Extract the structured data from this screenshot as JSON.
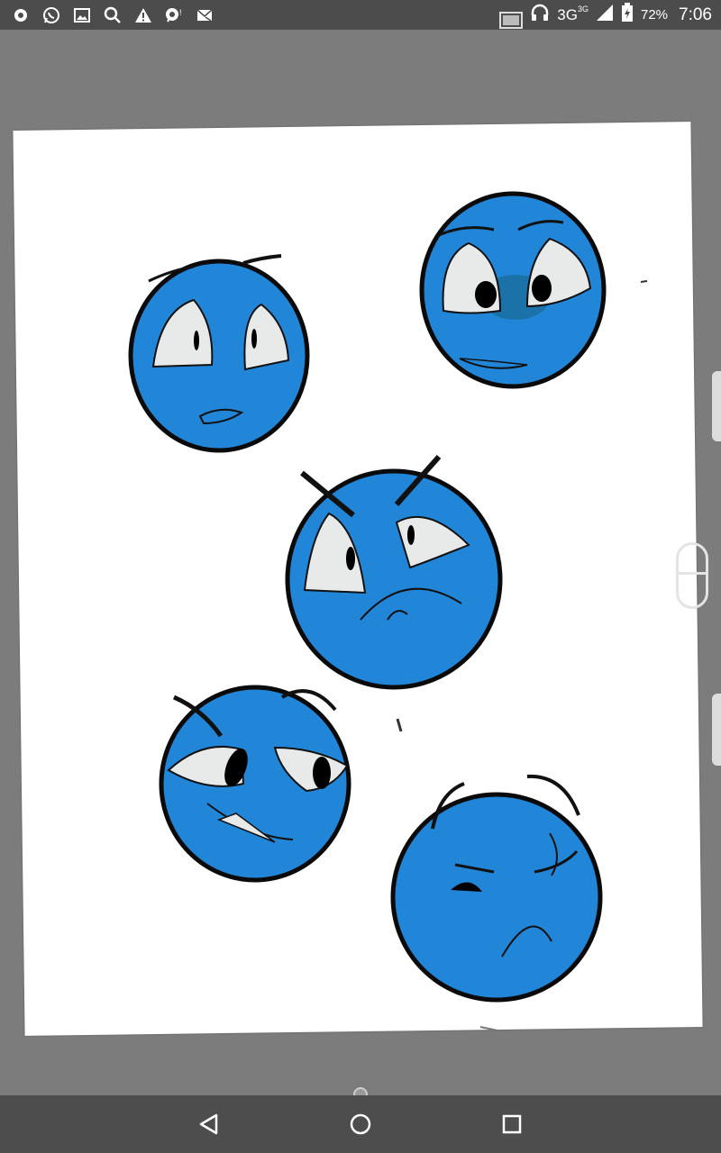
{
  "status_bar": {
    "battery_percent": "72%",
    "time": "7:06",
    "network": "3G",
    "network_sup": "3G",
    "left_icons": [
      "record-icon",
      "whatsapp-icon",
      "gallery-icon",
      "search-icon",
      "warning-icon",
      "chat-icon",
      "mail-icon"
    ],
    "right_icons": [
      "screenshot-icon",
      "headset-icon",
      "signal-icon",
      "battery-charging-icon"
    ]
  },
  "canvas": {
    "page_color": "#ffffff",
    "face_color": "#2286d8",
    "faces": [
      "face-surprised",
      "face-nervous",
      "face-angry",
      "face-smug",
      "face-grumpy"
    ]
  },
  "nav_bar": {
    "buttons": [
      "back-button",
      "home-button",
      "recents-button"
    ]
  }
}
